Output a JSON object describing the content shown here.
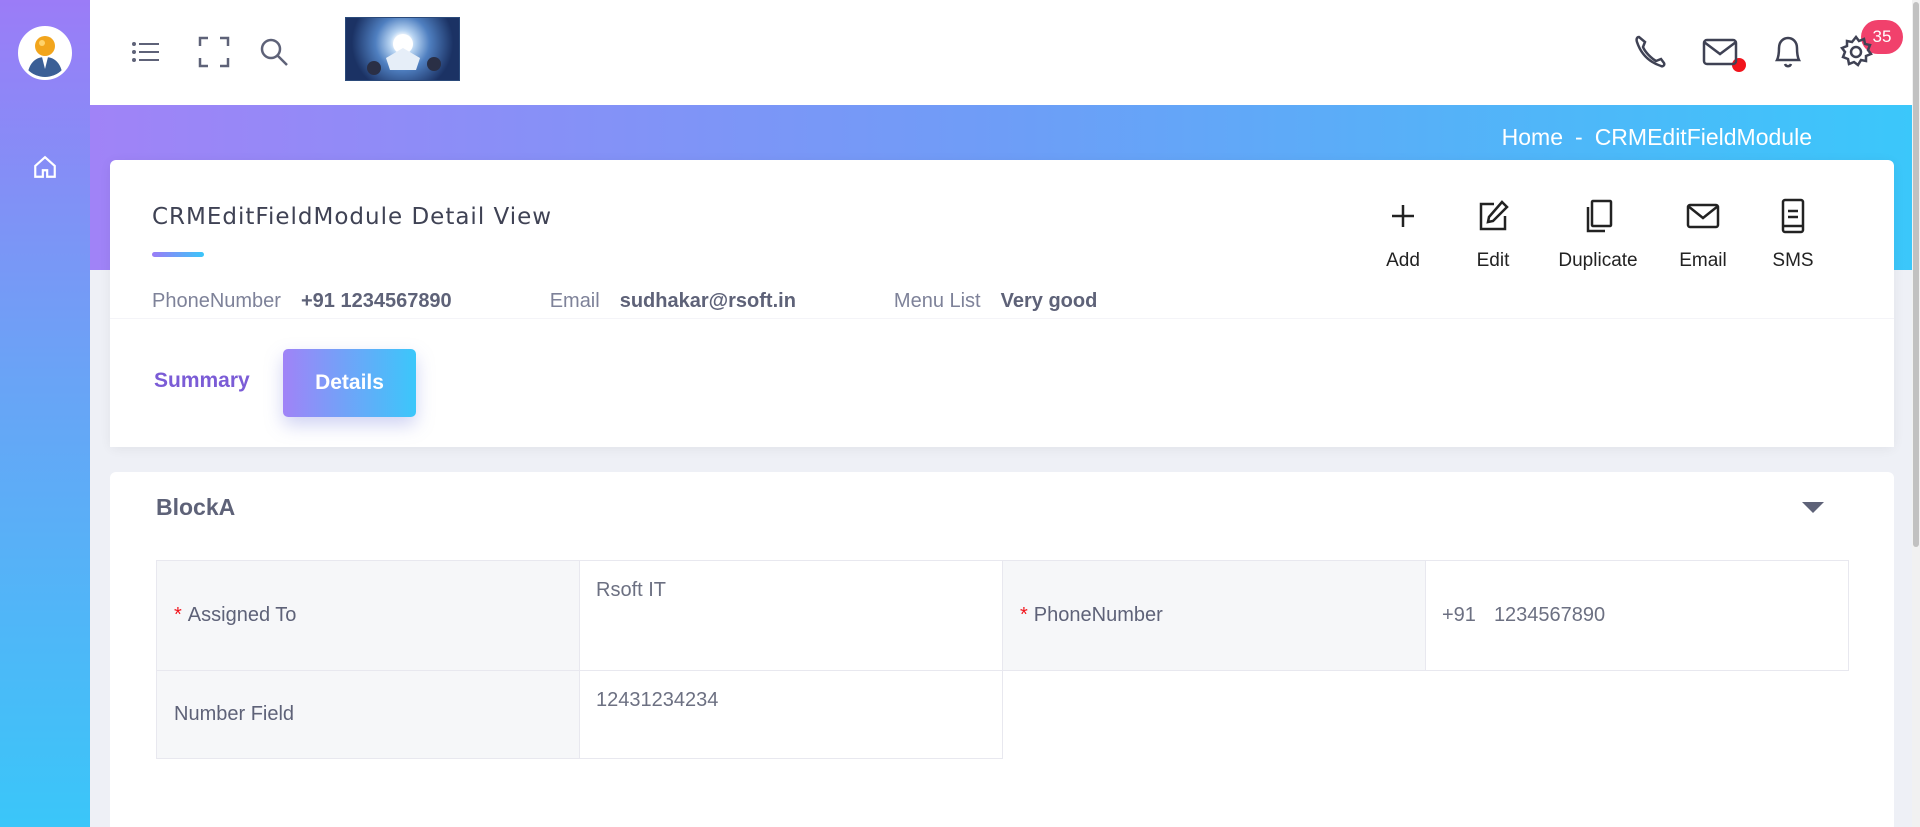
{
  "topbar": {
    "notification_count": "35"
  },
  "breadcrumb": {
    "home": "Home",
    "separator": "-",
    "current": "CRMEditFieldModule"
  },
  "record": {
    "title": "CRMEditFieldModule Detail View",
    "summary": [
      {
        "label": "PhoneNumber",
        "value": "+91 1234567890"
      },
      {
        "label": "Email",
        "value": "sudhakar@rsoft.in"
      },
      {
        "label": "Menu List",
        "value": "Very good"
      }
    ]
  },
  "actions": {
    "add": "Add",
    "edit": "Edit",
    "duplicate": "Duplicate",
    "email": "Email",
    "sms": "SMS"
  },
  "tabs": {
    "summary": "Summary",
    "details": "Details"
  },
  "blockA": {
    "title": "BlockA",
    "assigned_to_label": "Assigned To",
    "assigned_to_value": "Rsoft IT",
    "phone_label": "PhoneNumber",
    "phone_code": "+91",
    "phone_number": "1234567890",
    "number_field_label": "Number Field",
    "number_field_value": "12431234234",
    "required_mark": "*"
  },
  "colors": {
    "gradient_start": "#a083f7",
    "gradient_end": "#3bc7fa",
    "badge": "#f1416c",
    "accent_text": "#7b5cd6"
  }
}
